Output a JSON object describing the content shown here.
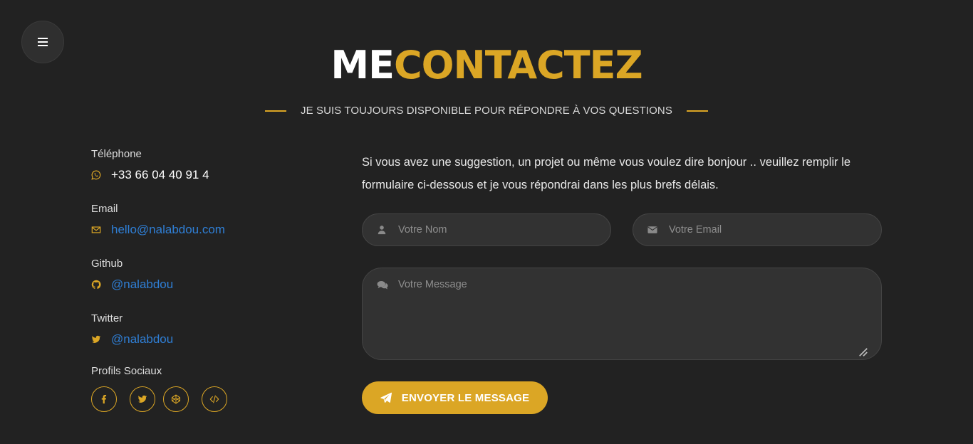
{
  "header": {
    "title_part1": "ME",
    "title_part2": "CONTACTEZ",
    "subtitle": "JE SUIS TOUJOURS DISPONIBLE POUR RÉPONDRE À VOS QUESTIONS"
  },
  "contact": {
    "phone": {
      "label": "Téléphone",
      "value": "+33 66 04 40 91 4",
      "icon": "whatsapp-icon"
    },
    "email": {
      "label": "Email",
      "value": "hello@nalabdou.com",
      "icon": "envelope-icon"
    },
    "github": {
      "label": "Github",
      "value": "@nalabdou",
      "icon": "github-icon"
    },
    "twitter": {
      "label": "Twitter",
      "value": "@nalabdou",
      "icon": "twitter-icon"
    },
    "social_label": "Profils Sociaux",
    "social_icons": [
      "facebook-icon",
      "twitter-icon",
      "codepen-icon",
      "code-icon"
    ]
  },
  "form": {
    "intro": "Si vous avez une suggestion, un projet ou même vous voulez dire bonjour .. veuillez remplir le formulaire ci-dessous et je vous répondrai dans les plus brefs délais.",
    "name_placeholder": "Votre Nom",
    "email_placeholder": "Votre Email",
    "message_placeholder": "Votre Message",
    "submit_label": "ENVOYER LE MESSAGE"
  },
  "colors": {
    "background": "#222222",
    "accent": "#dba625",
    "link": "#2f7fd6",
    "field": "#323232"
  }
}
